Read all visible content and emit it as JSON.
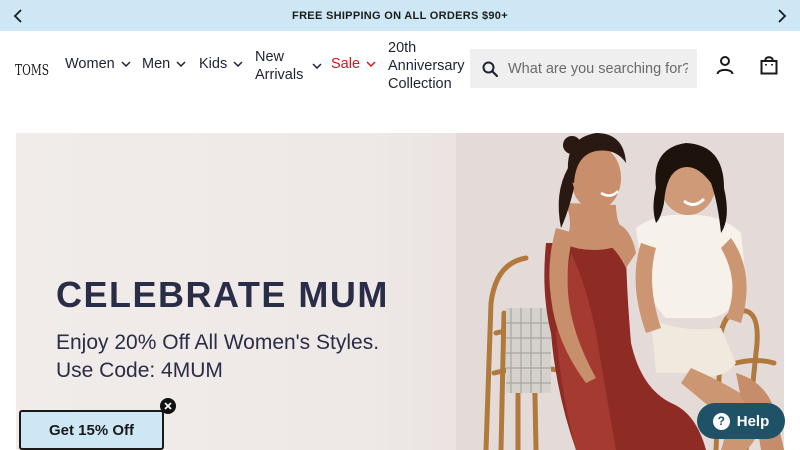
{
  "promo": {
    "text": "FREE SHIPPING ON ALL ORDERS $90+",
    "prev_icon": "chevron-left-icon",
    "next_icon": "chevron-right-icon"
  },
  "header": {
    "logo_text": "TOMS",
    "nav": [
      {
        "label": "Women",
        "has_dropdown": true
      },
      {
        "label": "Men",
        "has_dropdown": true
      },
      {
        "label": "Kids",
        "has_dropdown": true
      },
      {
        "label_line1": "New",
        "label_line2": "Arrivals",
        "has_dropdown": true
      },
      {
        "label": "Sale",
        "has_dropdown": true,
        "color": "#d9141f"
      },
      {
        "label_line1": "20th",
        "label_line2": "Anniversary",
        "label_line3": "Collection",
        "has_dropdown": false
      }
    ],
    "search": {
      "placeholder": "What are you searching for?",
      "value": "",
      "icon": "search-icon"
    },
    "account_icon": "user-icon",
    "cart_icon": "shopping-bag-icon"
  },
  "hero": {
    "title": "CELEBRATE MUM",
    "subtitle_line1": "Enjoy 20% Off All Women's Styles.",
    "subtitle_line2": "Use Code: 4MUM"
  },
  "popup": {
    "label": "Get 15% Off",
    "close_icon": "close-icon"
  },
  "help": {
    "label": "Help",
    "icon": "question-icon"
  },
  "colors": {
    "promo_bg": "#cde8f4",
    "sale_red": "#d9141f",
    "help_bg": "#1f5266",
    "hero_text": "#2a2d47"
  }
}
